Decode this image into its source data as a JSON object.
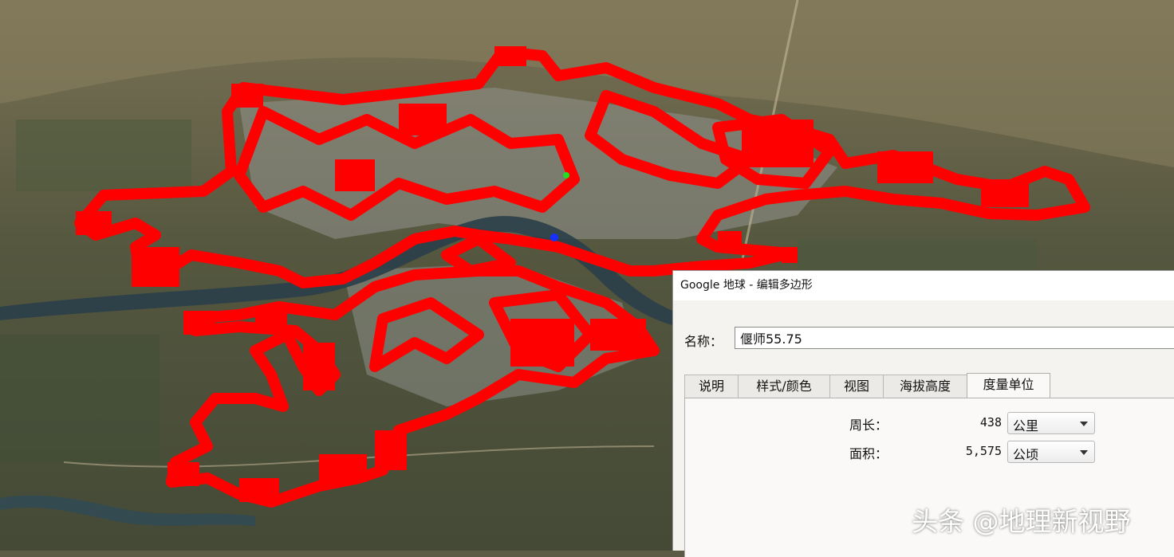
{
  "window": {
    "title": "Google 地球 - 编辑多边形"
  },
  "form": {
    "name_label": "名称：",
    "name_value": "偃师55.75"
  },
  "tabs": [
    {
      "label": "说明",
      "active": false
    },
    {
      "label": "样式/颜色",
      "active": false
    },
    {
      "label": "视图",
      "active": false
    },
    {
      "label": "海拔高度",
      "active": false
    },
    {
      "label": "度量单位",
      "active": true
    }
  ],
  "measurements": {
    "perimeter": {
      "label": "周长：",
      "value": "438",
      "unit": "公里"
    },
    "area": {
      "label": "面积：",
      "value": "5,575",
      "unit": "公顷"
    }
  },
  "watermark": "头条 @地理新视野",
  "map": {
    "polygon_color": "#ff0000",
    "river_color": "#2a3f4a"
  }
}
